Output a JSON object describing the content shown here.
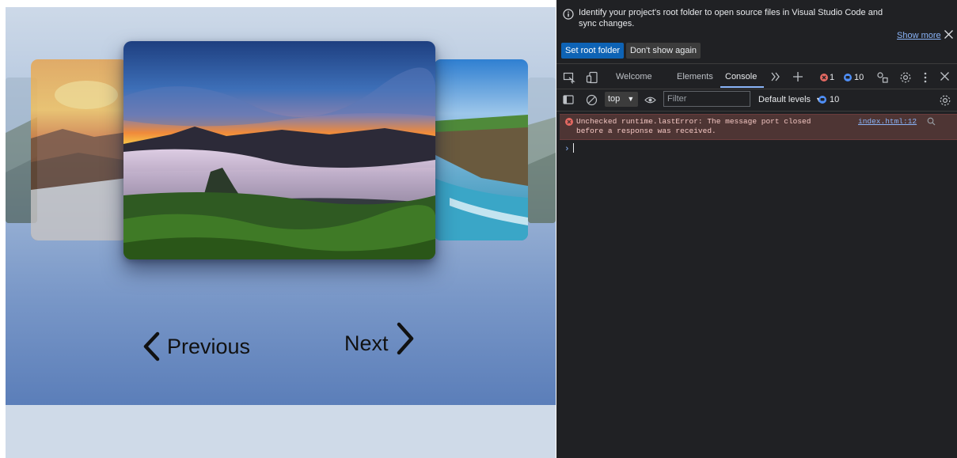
{
  "carousel": {
    "previous_label": "Previous",
    "next_label": "Next",
    "slides": [
      "mountain-sunrise",
      "sunset-mountain",
      "sea-cliff",
      "forest",
      "hills"
    ]
  },
  "devtools": {
    "infobar": {
      "message": "Identify your project's root folder to open source files in Visual Studio Code and sync changes.",
      "show_more": "Show more",
      "set_root_button": "Set root folder",
      "dont_show_button": "Don't show again"
    },
    "tabs": {
      "welcome": "Welcome",
      "elements": "Elements",
      "console": "Console"
    },
    "badges": {
      "errors": "1",
      "messages": "10"
    },
    "filterbar": {
      "context": "top",
      "filter_placeholder": "Filter",
      "levels": "Default levels",
      "message_count": "10"
    },
    "console": {
      "error_message": "Unchecked runtime.lastError: The message port closed\nbefore a response was received.",
      "error_source": "index.html:12"
    }
  },
  "colors": {
    "accent": "#8ab4f8",
    "primary_button": "#0e63b5",
    "error_bg": "#4e3534",
    "error_badge": "#e46962",
    "info_badge": "#4f8ff7"
  }
}
